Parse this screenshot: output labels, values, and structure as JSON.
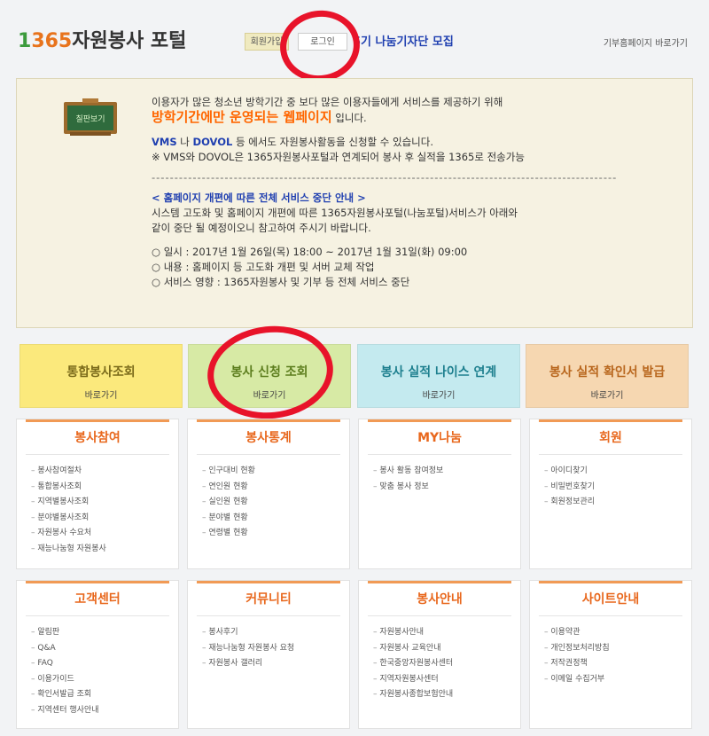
{
  "header": {
    "logo_num_1": "1",
    "logo_num_rest": "365",
    "logo_text": "자원봉사 포털",
    "join_label": "회원가입",
    "login_label": "로그인",
    "recruit_text": "5기 나눔기자단 모집",
    "donate_link": "기부홈페이지 바로가기"
  },
  "notice": {
    "board_text": "칠판보기",
    "line1": "이용자가 많은 청소년 방학기간 중 보다 많은 이용자들에게 서비스를 제공하기 위해",
    "line2_highlight": "방학기간에만 운영되는 웹페이지",
    "line2_suffix": " 입니다.",
    "vms": "VMS",
    "na": " 나 ",
    "dovol": "DOVOL",
    "line3_suffix": " 등 에서도 자원봉사활동을 신청할 수 있습니다.",
    "line4": "※ VMS와 DOVOL은 1365자원봉사포털과 연계되어 봉사 후 실적을 1365로 전송가능",
    "separator": "------------------------------------------------------------------------------------------------------",
    "outage_title": "< 홈페이지 개편에 따른 전체 서비스 중단 안내 >",
    "outage_line1": "시스템 고도화 및 홈페이지 개편에 따른 1365자원봉사포털(나눔포털)서비스가 아래와",
    "outage_line2": "같이 중단 될 예정이오니 참고하여 주시기 바랍니다.",
    "schedule": "○ 일시 : 2017년 1월 26일(목) 18:00 ~ 2017년 1월 31일(화) 09:00",
    "content": "○ 내용 : 홈페이지 등 고도화 개편 및 서버 교체 작업",
    "impact": "○ 서비스 영향 : 1365자원봉사 및 기부 등 전체 서비스 중단"
  },
  "quick": [
    {
      "title": "통합봉사조회",
      "sub": "바로가기"
    },
    {
      "title": "봉사 신청 조회",
      "sub": "바로가기"
    },
    {
      "title": "봉사 실적 나이스 연계",
      "sub": "바로가기"
    },
    {
      "title": "봉사 실적 확인서 발급",
      "sub": "바로가기"
    }
  ],
  "cards": [
    {
      "title": "봉사참여",
      "items": [
        "봉사참여절차",
        "통합봉사조회",
        "지역별봉사조회",
        "분야별봉사조회",
        "자원봉사 수요처",
        "재능나눔형 자원봉사"
      ]
    },
    {
      "title": "봉사통계",
      "items": [
        "인구대비 현황",
        "연인원 현황",
        "실인원 현황",
        "분야별 현황",
        "연령별 현황"
      ]
    },
    {
      "title": "MY나눔",
      "items": [
        "봉사 활동 참여정보",
        "맞춤 봉사 정보"
      ]
    },
    {
      "title": "회원",
      "items": [
        "아이디찾기",
        "비밀번호찾기",
        "회원정보관리"
      ]
    },
    {
      "title": "고객센터",
      "items": [
        "알림판",
        "Q&A",
        "FAQ",
        "이용가이드",
        "확인서발급 조회",
        "지역센터 행사안내"
      ]
    },
    {
      "title": "커뮤니티",
      "items": [
        "봉사후기",
        "재능나눔형 자원봉사 요청",
        "자원봉사 갤러리"
      ]
    },
    {
      "title": "봉사안내",
      "items": [
        "자원봉사안내",
        "자원봉사 교육안내",
        "한국중앙자원봉사센터",
        "지역자원봉사센터",
        "자원봉사종합보험안내"
      ]
    },
    {
      "title": "사이트안내",
      "items": [
        "이용약관",
        "개인정보처리방침",
        "저작권정책",
        "이메일 수집거부"
      ]
    }
  ],
  "colors": {
    "annotation": "#e8132a",
    "accent_orange": "#ff6600",
    "link_blue": "#1f3fb0"
  }
}
